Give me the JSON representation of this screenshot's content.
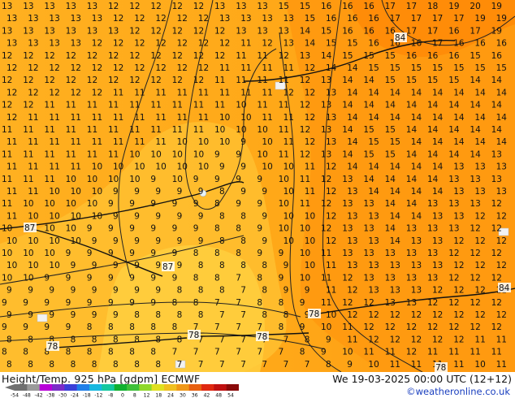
{
  "footer": {
    "title": "Height/Temp. 925 hPa [gdpm] ECMWF",
    "datetime": "We 19-03-2025 00:00 UTC (12+12)",
    "credit": "©weatheronline.co.uk"
  },
  "legend": {
    "ticks": [
      "-54",
      "-48",
      "-42",
      "-38",
      "-30",
      "-24",
      "-18",
      "-12",
      "-8",
      "0",
      "8",
      "12",
      "18",
      "24",
      "30",
      "36",
      "42",
      "48",
      "54"
    ],
    "colors": [
      "#707070",
      "#9a9a9a",
      "#b800d8",
      "#7b2cc8",
      "#3b3fd8",
      "#1f7fe8",
      "#18b8e0",
      "#14c8a0",
      "#10b030",
      "#3ec03a",
      "#8fd82a",
      "#e0e020",
      "#f0c020",
      "#f09818",
      "#e86010",
      "#e02810",
      "#c01010",
      "#8a0a0a"
    ]
  },
  "height_labels": [
    "84",
    "84",
    "87",
    "87",
    "78",
    "78",
    "78",
    "78",
    "78"
  ],
  "temperature_field": {
    "rows": [
      "13 13 13 13 13 12 12 12 12 12 13 13 13 15 15 16 16 16 17 17 18 19 20 19",
      "13 13 13 13 13 12 12 12 12 12 13 13 13 13 15 16 16 16 17 17 17 17 19 19",
      "13 13 13 13 13 13 12 12 12 12 12 13 13 13 14 15 16 16 16 17 17 16 17 19",
      "13 13 13 13 12 12 12 12 12 12 12 11 12 13 14 15 15 16 16 16 17 16 16 16",
      "12 12 12 12 12 12 12 12 12 12 12 11 11 12 13 14 15 15 15 16 16 16 15 16",
      "12 12 12 12 12 12 12 12 12 12 11 11 11 11 12 14 14 15 15 15 15 15 15 15",
      "12 12 12 12 12 12 12 12 12 12 11 11 11 11 12 13 14 14 15 15 15 15 14 14",
      "12 12 12 12 12 11 11 11 11 11 11 11 11 12 12 13 14 14 14 14 14 14 14 14",
      "12 12 11 11 11 11 11 11 11 11 11 10 11 11 12 13 14 14 14 14 14 14 14 14",
      "12 11 11 11 11 11 11 11 11 11 10 10 11 11 12 13 14 14 14 14 14 14 14 14",
      "11 11 11 11 11 11 11 11 11 11 10 10 10 11 12 13 14 15 15 14 14 14 14 14",
      "11 11 11 11 11 11 11 11 10 10 10 9 10 11 12 13 14 15 15 14 14 14 14 14",
      "11 11 11 11 11 11 10 10 10 10 9 9 10 11 12 13 14 15 15 14 14 14 14 13",
      "11 11 11 11 10 10 10 10 10 10 9 9 10 10 11 12 14 14 14 14 14 13 13 13",
      "11 11 11 10 10 10 10 9 10 9 9 9 9 10 11 12 13 14 14 14 14 13 13 13",
      "11 11 10 10 10 9 9 9 9 9 8 9 9 10 11 12 13 14 14 14 14 13 13 13",
      "11 10 10 10 10 9 9 9 9 9 8 9 9 10 11 12 13 13 14 14 13 13 13 12",
      "11 10 10 10 10 9 9 9 9 9 8 8 9 10 10 12 13 13 14 14 13 13 12 12",
      "10 10 10 10 9 9 9 9 9 9 8 8 9 10 10 12 13 13 14 13 13 13 12 12",
      "10 10 10 10 9 9 9 9 9 9 8 8 9 10 10 12 13 13 14 13 13 12 12 12",
      "10 10 10 9 9 9 9 9 9 8 8 8 9 9 10 11 13 13 13 13 13 12 12 12",
      "10 10 10 9 9 9 9 9 9 8 8 8 8 9 10 11 13 13 13 13 13 12 12 12",
      "10 10 9 9 9 9 9 9 9 8 8 7 8 9 10 11 12 13 13 13 13 12 12 12",
      "9 9 9 9 9 9 9 9 8 8 8 7 8 9 9 11 12 13 13 13 12 12 12 11",
      "9 9 9 9 9 9 9 9 8 8 7 7 8 8 9 11 12 12 13 13 12 12 12 12",
      "9 9 9 9 9 9 8 8 8 8 7 7 8 8 9 10 12 12 12 12 12 12 12 12",
      "9 9 9 9 8 8 8 8 8 7 7 7 7 8 9 10 11 12 12 12 12 12 12 12",
      "8 8 8 8 8 8 8 8 8 7 7 7 7 7 8 9 11 12 12 12 12 12 11 11",
      "8 8 8 8 8 8 8 8 7 7 7 7 7 7 8 9 10 11 11 12 11 11 11 11",
      "8 8 8 8 8 8 8 8 7 7 7 7 7 7 7 8 9 10 11 11 11 11 10 11"
    ]
  }
}
